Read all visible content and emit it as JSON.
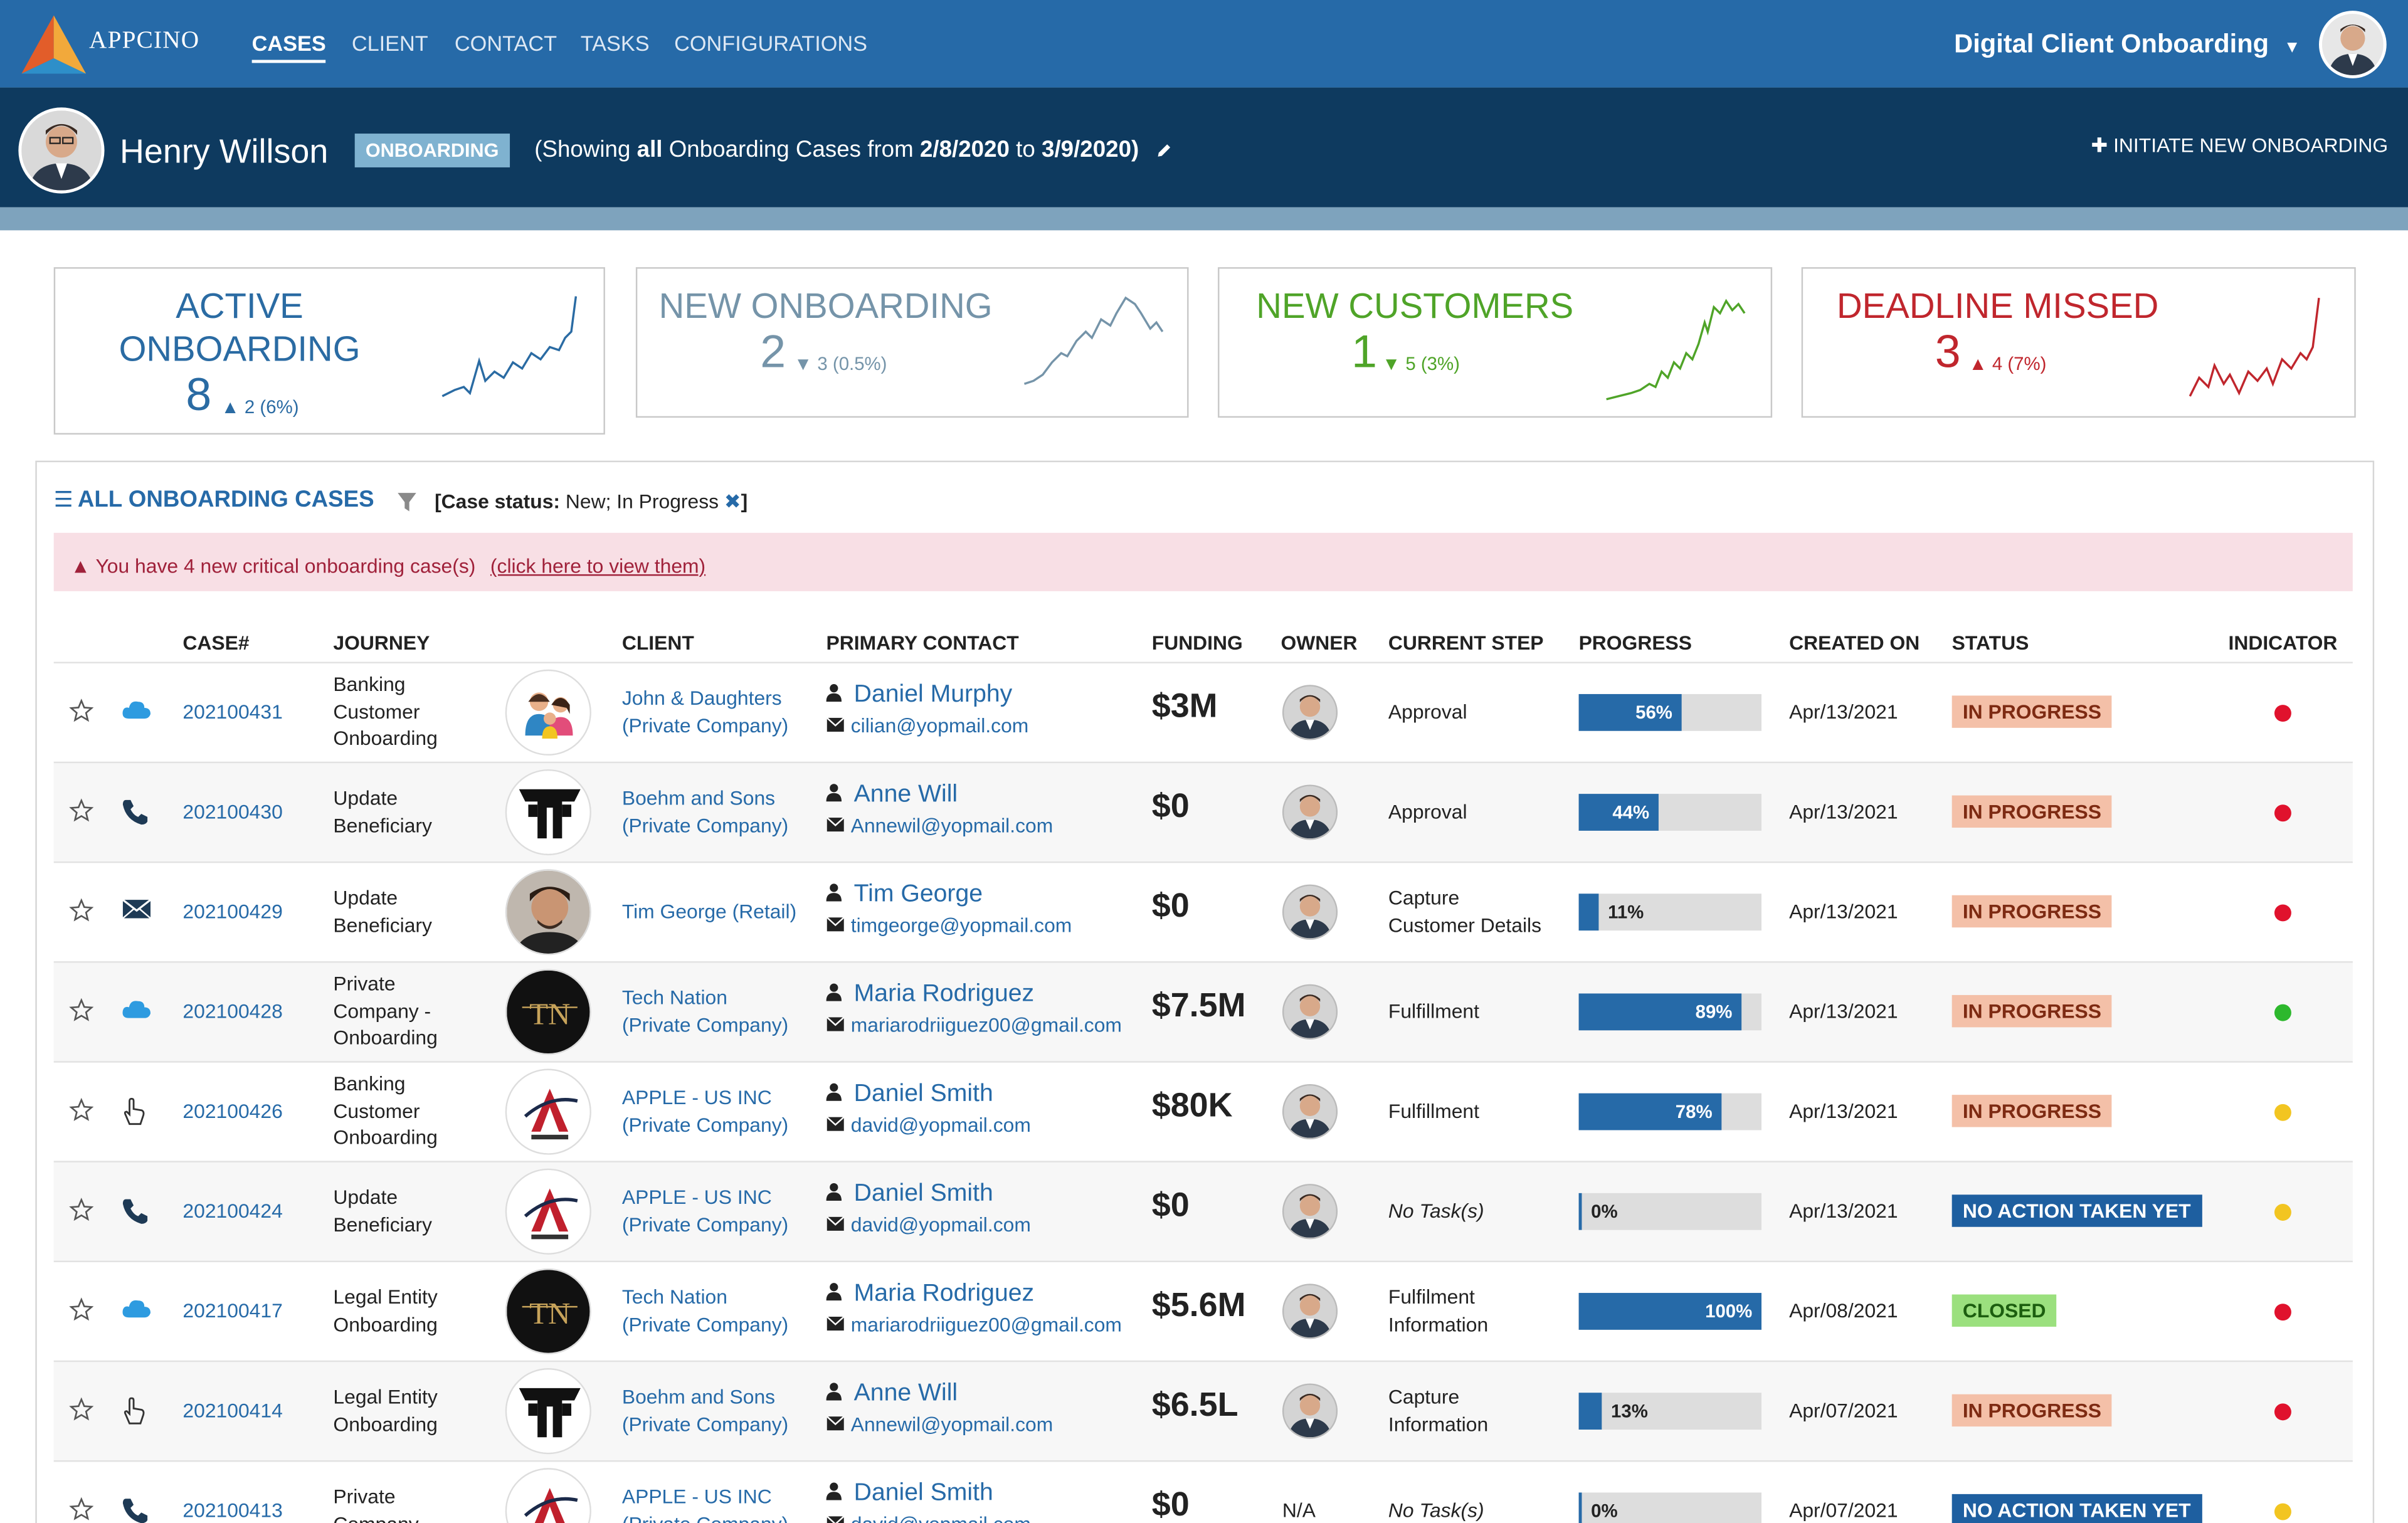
{
  "app": {
    "brand": "APPCINO",
    "selector": "Digital Client Onboarding"
  },
  "nav": [
    "CASES",
    "CLIENT",
    "CONTACT",
    "TASKS",
    "CONFIGURATIONS"
  ],
  "user": {
    "name": "Henry Willson",
    "badge": "ONBOARDING",
    "range_prefix": "(Showing",
    "range_all": "all",
    "range_mid": "Onboarding Cases from",
    "range_from": "2/8/2020",
    "range_to_word": "to",
    "range_to": "3/9/2020)",
    "initiate": "INITIATE NEW ONBOARDING"
  },
  "kpis": [
    {
      "title1": "ACTIVE",
      "title2": "ONBOARDING",
      "value": "8",
      "delta": "2 (6%)",
      "trend": "up",
      "color": "#2a6ba3"
    },
    {
      "title1": "NEW ONBOARDING",
      "title2": "",
      "value": "2",
      "delta": "3 (0.5%)",
      "trend": "down",
      "color": "#7594a9"
    },
    {
      "title1": "NEW CUSTOMERS",
      "title2": "",
      "value": "1",
      "delta": "5 (3%)",
      "trend": "down",
      "color": "#4fa428"
    },
    {
      "title1": "DEADLINE MISSED",
      "title2": "",
      "value": "3",
      "delta": "4 (7%)",
      "trend": "up",
      "color": "#c0262d"
    }
  ],
  "panel": {
    "title": "ALL ONBOARDING CASES",
    "filter_label": "[Case status:",
    "filter_value": "New; In Progress",
    "filter_close": "]",
    "alert": "You have 4 new critical onboarding case(s)",
    "alert_link": "(click here to view them)"
  },
  "columns": [
    "CASE#",
    "JOURNEY",
    "CLIENT",
    "PRIMARY CONTACT",
    "FUNDING",
    "OWNER",
    "CURRENT STEP",
    "PROGRESS",
    "CREATED ON",
    "STATUS",
    "INDICATOR"
  ],
  "rows": [
    {
      "channel": "cloud",
      "case": "202100431",
      "journey": [
        "Banking",
        "Customer",
        "Onboarding"
      ],
      "logo": "family",
      "client1": "John & Daughters",
      "client2": "(Private Company)",
      "contact": "Daniel Murphy",
      "email": "cilian@yopmail.com",
      "funding": "$3M",
      "owner": "avatar",
      "step": [
        "Approval"
      ],
      "step_italic": false,
      "progress": 56,
      "progress_label": "56%",
      "created": "Apr/13/2021",
      "status": "IN PROGRESS",
      "status_type": "ip",
      "indicator": "#e0122d"
    },
    {
      "channel": "phone",
      "case": "202100430",
      "journey": [
        "Update",
        "Beneficiary"
      ],
      "logo": "bs",
      "client1": "Boehm and Sons",
      "client2": "(Private Company)",
      "contact": "Anne Will",
      "email": "Annewil@yopmail.com",
      "funding": "$0",
      "owner": "avatar",
      "step": [
        "Approval"
      ],
      "step_italic": false,
      "progress": 44,
      "progress_label": "44%",
      "created": "Apr/13/2021",
      "status": "IN PROGRESS",
      "status_type": "ip",
      "indicator": "#e0122d"
    },
    {
      "channel": "mail",
      "case": "202100429",
      "journey": [
        "Update",
        "Beneficiary"
      ],
      "logo": "person",
      "client1": "Tim George (Retail)",
      "client2": "",
      "contact": "Tim George",
      "email": "timgeorge@yopmail.com",
      "funding": "$0",
      "owner": "avatar",
      "step": [
        "Capture",
        "Customer Details"
      ],
      "step_italic": false,
      "progress": 11,
      "progress_label": "11%",
      "created": "Apr/13/2021",
      "status": "IN PROGRESS",
      "status_type": "ip",
      "indicator": "#e0122d"
    },
    {
      "channel": "cloud",
      "case": "202100428",
      "journey": [
        "Private",
        "Company -",
        "Onboarding"
      ],
      "logo": "tn",
      "client1": "Tech Nation",
      "client2": "(Private Company)",
      "contact": "Maria Rodriguez",
      "email": "mariarodriiguez00@gmail.com",
      "funding": "$7.5M",
      "owner": "avatar",
      "step": [
        "Fulfillment"
      ],
      "step_italic": false,
      "progress": 89,
      "progress_label": "89%",
      "created": "Apr/13/2021",
      "status": "IN PROGRESS",
      "status_type": "ip",
      "indicator": "#2db82d"
    },
    {
      "channel": "hand",
      "case": "202100426",
      "journey": [
        "Banking",
        "Customer",
        "Onboarding"
      ],
      "logo": "a",
      "client1": "APPLE - US INC",
      "client2": "(Private Company)",
      "contact": "Daniel Smith",
      "email": "david@yopmail.com",
      "funding": "$80K",
      "owner": "avatar",
      "step": [
        "Fulfillment"
      ],
      "step_italic": false,
      "progress": 78,
      "progress_label": "78%",
      "created": "Apr/13/2021",
      "status": "IN PROGRESS",
      "status_type": "ip",
      "indicator": "#f2c521"
    },
    {
      "channel": "phone",
      "case": "202100424",
      "journey": [
        "Update",
        "Beneficiary"
      ],
      "logo": "a",
      "client1": "APPLE - US INC",
      "client2": "(Private Company)",
      "contact": "Daniel Smith",
      "email": "david@yopmail.com",
      "funding": "$0",
      "owner": "avatar",
      "step": [
        "No Task(s)"
      ],
      "step_italic": true,
      "progress": 0,
      "progress_label": "0%",
      "created": "Apr/13/2021",
      "status": "NO ACTION TAKEN YET",
      "status_type": "na",
      "indicator": "#f2c521"
    },
    {
      "channel": "cloud",
      "case": "202100417",
      "journey": [
        "Legal Entity",
        "Onboarding"
      ],
      "logo": "tn",
      "client1": "Tech Nation",
      "client2": "(Private Company)",
      "contact": "Maria Rodriguez",
      "email": "mariarodriiguez00@gmail.com",
      "funding": "$5.6M",
      "owner": "avatar",
      "step": [
        "Fulfilment",
        "Information"
      ],
      "step_italic": false,
      "progress": 100,
      "progress_label": "100%",
      "created": "Apr/08/2021",
      "status": "CLOSED",
      "status_type": "cl",
      "indicator": "#e0122d"
    },
    {
      "channel": "hand",
      "case": "202100414",
      "journey": [
        "Legal Entity",
        "Onboarding"
      ],
      "logo": "bs",
      "client1": "Boehm and Sons",
      "client2": "(Private Company)",
      "contact": "Anne Will",
      "email": "Annewil@yopmail.com",
      "funding": "$6.5L",
      "owner": "avatar",
      "step": [
        "Capture",
        "Information"
      ],
      "step_italic": false,
      "progress": 13,
      "progress_label": "13%",
      "created": "Apr/07/2021",
      "status": "IN PROGRESS",
      "status_type": "ip",
      "indicator": "#e0122d"
    },
    {
      "channel": "phone",
      "case": "202100413",
      "journey": [
        "Private",
        "Company -"
      ],
      "logo": "a",
      "client1": "APPLE - US INC",
      "client2": "(Private Company)",
      "contact": "Daniel Smith",
      "email": "david@yopmail.com",
      "funding": "$0",
      "owner": "N/A",
      "step": [
        "No Task(s)"
      ],
      "step_italic": true,
      "progress": 0,
      "progress_label": "0%",
      "created": "Apr/07/2021",
      "status": "NO ACTION TAKEN YET",
      "status_type": "na",
      "indicator": "#f2c521"
    }
  ]
}
